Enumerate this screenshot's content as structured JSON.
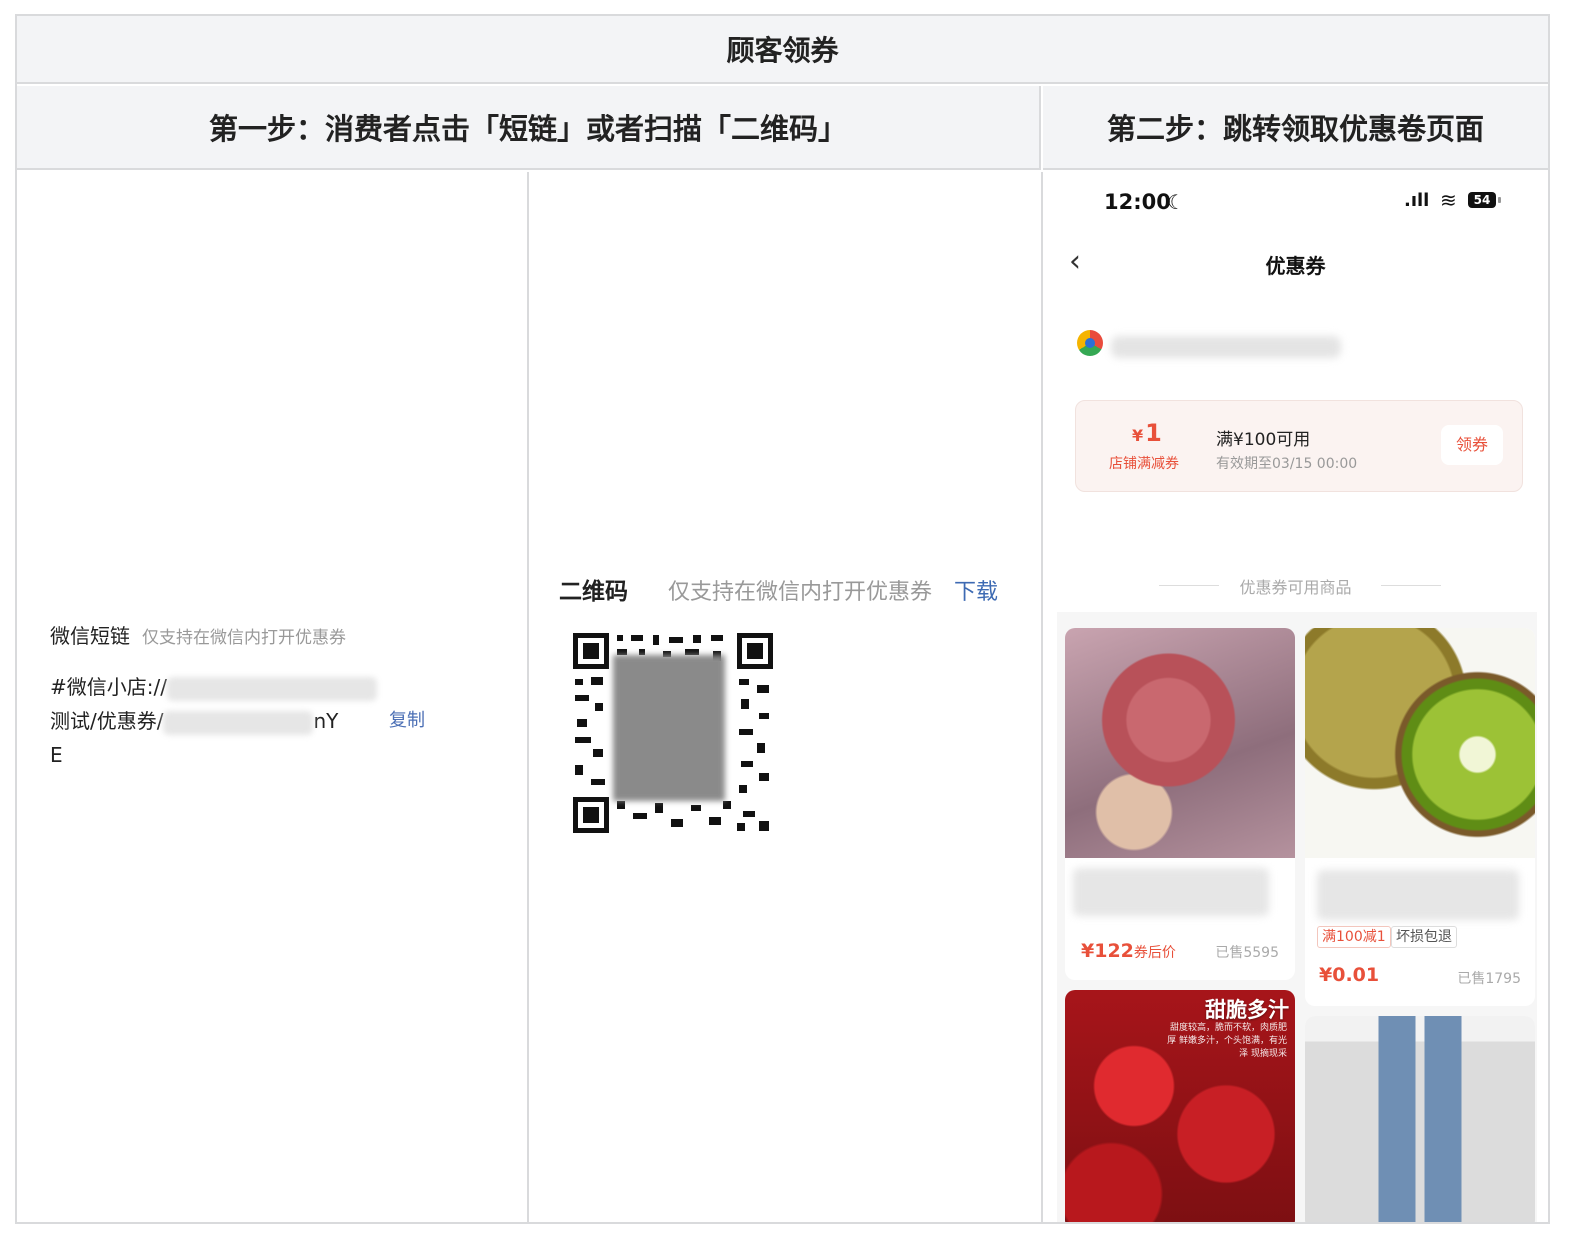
{
  "header": {
    "title": "顾客领券",
    "step1": "第一步：消费者点击「短链」或者扫描「二维码」",
    "step2": "第二步：跳转领取优惠卷页面"
  },
  "short_link": {
    "title": "微信短链",
    "hint": "仅支持在微信内打开优惠券",
    "line1_prefix": "#微信小店://",
    "line2_prefix": "测试/优惠券/",
    "line2_suffix": "nY",
    "line3": "E",
    "copy_label": "复制"
  },
  "qr": {
    "title": "二维码",
    "hint": "仅支持在微信内打开优惠券",
    "download_label": "下载"
  },
  "phone": {
    "status": {
      "time": "12:00",
      "battery": "54"
    },
    "nav_title": "优惠券",
    "coupon": {
      "currency": "¥",
      "amount": "1",
      "type": "店铺满减券",
      "condition": "满¥100可用",
      "expiry": "有效期至03/15 00:00",
      "claim_label": "领券"
    },
    "section_title": "优惠券可用商品",
    "products": [
      {
        "price": "¥122",
        "price_suffix": "券后价",
        "sold": "已售5595"
      },
      {
        "tags": [
          "满100减1",
          "坏损包退"
        ],
        "price": "¥0.01",
        "sold": "已售1795"
      },
      {
        "image_text": "甜脆多汁",
        "image_subtext": "甜度较高，脆而不软，肉质肥厚 鲜嫩多汁，个头饱满，有光泽 现摘现采"
      },
      {}
    ]
  },
  "colors": {
    "accent_red": "#e8503a",
    "link_blue": "#3d6ab3",
    "header_bg": "#f3f4f6",
    "border": "#d9dadc"
  }
}
